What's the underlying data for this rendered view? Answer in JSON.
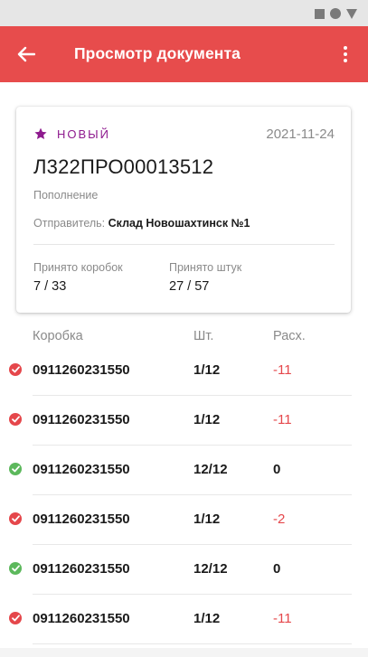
{
  "appbar": {
    "title": "Просмотр документа"
  },
  "document": {
    "status": "НОВЫЙ",
    "date": "2021-11-24",
    "number": "Л322ПРО00013512",
    "type": "Пополнение",
    "sender_label": "Отправитель:",
    "sender_value": "Склад Новошахтинск №1",
    "stats": [
      {
        "label": "Принято коробок",
        "value": "7 / 33"
      },
      {
        "label": "Принято штук",
        "value": "27 / 57"
      }
    ]
  },
  "table": {
    "headers": {
      "box": "Коробка",
      "pcs": "Шт.",
      "diff": "Расх."
    },
    "rows": [
      {
        "status": "error",
        "box": "0911260231550",
        "pcs": "1/12",
        "diff": "-11"
      },
      {
        "status": "error",
        "box": "0911260231550",
        "pcs": "1/12",
        "diff": "-11"
      },
      {
        "status": "ok",
        "box": "0911260231550",
        "pcs": "12/12",
        "diff": "0"
      },
      {
        "status": "error",
        "box": "0911260231550",
        "pcs": "1/12",
        "diff": "-2"
      },
      {
        "status": "ok",
        "box": "0911260231550",
        "pcs": "12/12",
        "diff": "0"
      },
      {
        "status": "error",
        "box": "0911260231550",
        "pcs": "1/12",
        "diff": "-11"
      }
    ]
  },
  "colors": {
    "primary": "#e74c4c",
    "status_new": "#8e1a8e",
    "error": "#e5474b",
    "ok": "#5cb85c"
  },
  "icons": {
    "back": "arrow-left-icon",
    "more": "more-vertical-icon",
    "status": "star-icon",
    "row_error": "check-icon",
    "row_ok": "check-icon"
  }
}
